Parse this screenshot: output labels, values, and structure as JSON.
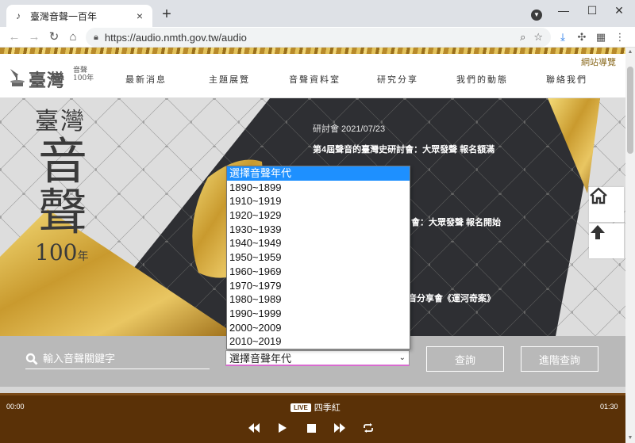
{
  "browser": {
    "tab_title": "臺灣音聲一百年",
    "tab_close": "×",
    "new_tab": "+",
    "url": "https://audio.nmth.gov.tw/audio",
    "window": {
      "minimize": "—",
      "maximize": "☐",
      "close": "✕"
    }
  },
  "site": {
    "sitemap_label": "網站導覽",
    "logo": {
      "main": "臺灣",
      "sub1": "音聲",
      "sub2": "100年"
    },
    "nav": [
      "最新消息",
      "主題展覽",
      "音聲資料室",
      "研究分享",
      "我們的動態",
      "聯絡我們"
    ],
    "hero_title": {
      "line1": "臺灣",
      "line2": "音",
      "line3": "聲",
      "num": "100",
      "unit": "年"
    },
    "news": {
      "date": "研討會 2021/07/23",
      "headline1": "第4屆聲音的臺灣史研討會：大眾發聲 報名額滿",
      "headline2": "會：大眾發聲 報名開始",
      "headline3": "音分享會《運河奇案》"
    }
  },
  "search": {
    "keyword_placeholder": "輸入音聲關鍵字",
    "year_selected": "選擇音聲年代",
    "query_label": "查詢",
    "advanced_label": "進階查詢"
  },
  "year_options": [
    "選擇音聲年代",
    "1890~1899",
    "1910~1919",
    "1920~1929",
    "1930~1939",
    "1940~1949",
    "1950~1959",
    "1960~1969",
    "1970~1979",
    "1980~1989",
    "1990~1999",
    "2000~2009",
    "2010~2019"
  ],
  "player": {
    "time_current": "00:00",
    "time_total": "01:30",
    "live_badge": "LIVE",
    "track_title": "四季紅"
  },
  "colors": {
    "player_bg": "#5a3107",
    "dropdown_highlight": "#1e90ff",
    "gold": "#c9a23a"
  }
}
